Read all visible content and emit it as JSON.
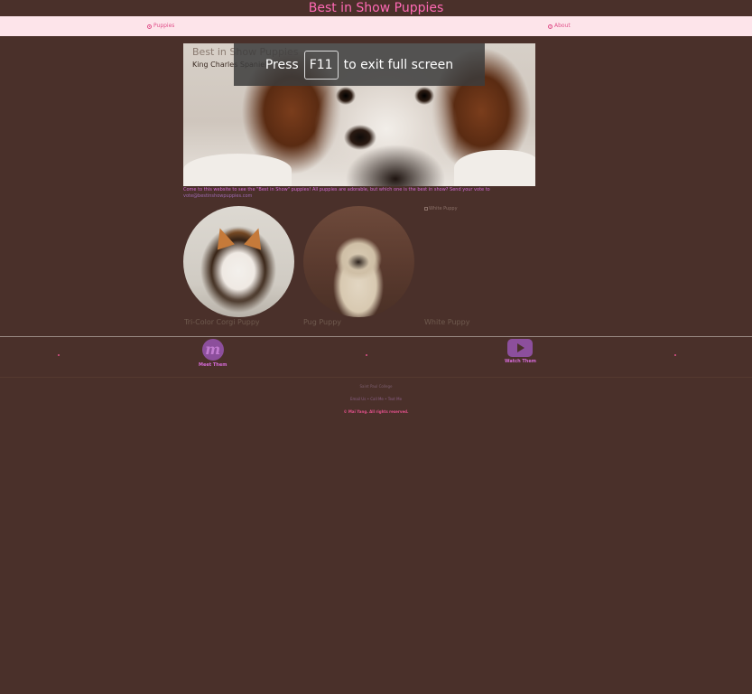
{
  "site": {
    "title": "Best in Show Puppies"
  },
  "nav": {
    "left": {
      "icon": "paw-icon",
      "label": "Puppies"
    },
    "right": {
      "icon": "question-circle-icon",
      "label": "About"
    }
  },
  "hero": {
    "title": "Best in Show Puppies",
    "subtitle": "King Charles Spaniel"
  },
  "fullscreen_banner": {
    "press": "Press",
    "key": "F11",
    "message": "to exit full screen"
  },
  "intro": {
    "text": "Come to this website to see the \"Best in Show\" puppies! All puppies are adorable, but which one is the best in show? Send your vote to",
    "email": "vote@bestinshowpuppies.com"
  },
  "puppies": [
    {
      "caption": "Tri-Color Corgi Puppy"
    },
    {
      "caption": "Pug Puppy"
    },
    {
      "caption": "White Puppy",
      "broken_alt": "White Puppy"
    }
  ],
  "social": {
    "meet": {
      "icon": "meetup-icon",
      "label": "Meet Them"
    },
    "watch": {
      "icon": "youtube-icon",
      "label": "Watch Them"
    }
  },
  "footer": {
    "org": "Saint Paul College",
    "links": "Email Us • Call Me • Text Me",
    "copyright": "© Mai Yang. All rights reserved."
  }
}
